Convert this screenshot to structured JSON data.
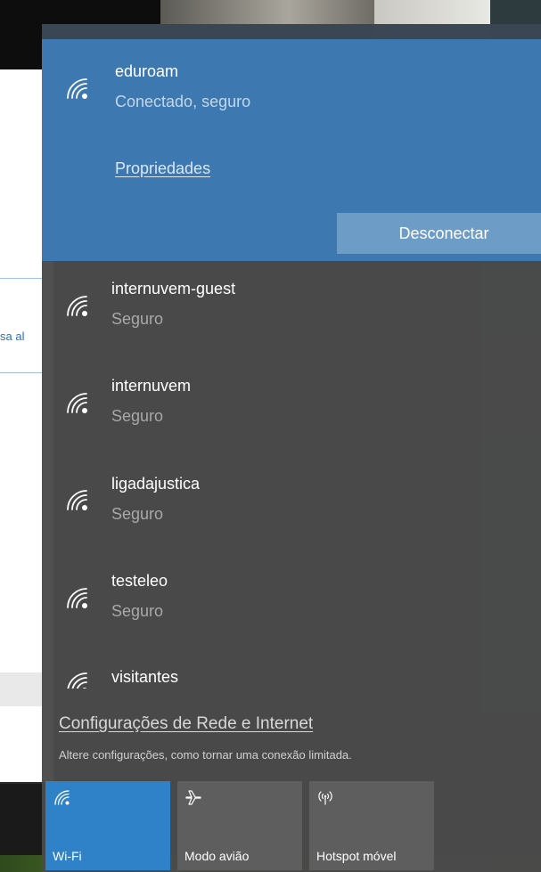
{
  "connected_network": {
    "name": "eduroam",
    "status": "Conectado, seguro",
    "properties_link": "Propriedades",
    "disconnect_button": "Desconectar",
    "icon": "wifi-icon"
  },
  "networks": [
    {
      "name": "internuvem-guest",
      "status": "Seguro",
      "icon": "wifi-icon"
    },
    {
      "name": "internuvem",
      "status": "Seguro",
      "icon": "wifi-icon"
    },
    {
      "name": "ligadajustica",
      "status": "Seguro",
      "icon": "wifi-icon"
    },
    {
      "name": "testeleo",
      "status": "Seguro",
      "icon": "wifi-icon"
    },
    {
      "name": "visitantes",
      "status": "",
      "icon": "wifi-icon"
    }
  ],
  "network_settings": {
    "link": "Configurações de Rede e Internet",
    "description": "Altere configurações, como tornar uma conexão limitada."
  },
  "quick_actions": [
    {
      "label": "Wi-Fi",
      "icon": "wifi-icon",
      "active": true
    },
    {
      "label": "Modo avião",
      "icon": "airplane-icon",
      "active": false
    },
    {
      "label": "Hotspot móvel",
      "icon": "hotspot-icon",
      "active": false
    }
  ],
  "background": {
    "partial_text": "sa al"
  },
  "colors": {
    "connected_bg": "#3d79b0",
    "flyout_bg": "#4a4a4a",
    "active_tile": "#2f82c8",
    "inactive_tile": "#5e5e5e",
    "disconnect_button": "#6d9cc6"
  }
}
